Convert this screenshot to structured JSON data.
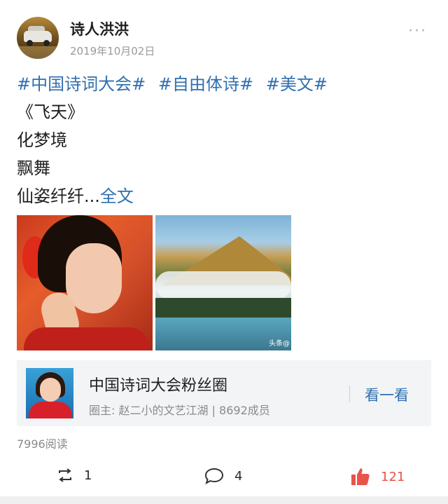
{
  "post": {
    "username": "诗人洪洪",
    "date": "2019年10月02日",
    "more_label": "···",
    "tags": [
      "#中国诗词大会#",
      "#自由体诗#",
      "#美文#"
    ],
    "lines": [
      "《飞天》",
      "化梦境",
      "飘舞",
      "仙姿纤纤..."
    ],
    "full_text_link": "全文",
    "image_watermark": "头条@"
  },
  "group_card": {
    "title": "中国诗词大会粉丝圈",
    "subtitle": "圈主: 赵二小的文艺江湖 | 8692成员",
    "button": "看一看"
  },
  "stats": {
    "reads": "7996阅读"
  },
  "actions": {
    "repost_count": "1",
    "comment_count": "4",
    "like_count": "121"
  },
  "colors": {
    "link_blue": "#2f6fb0",
    "like_red": "#e8534a"
  },
  "icons": {
    "repost": "repost-icon",
    "comment": "comment-icon",
    "like": "thumbs-up-icon"
  }
}
